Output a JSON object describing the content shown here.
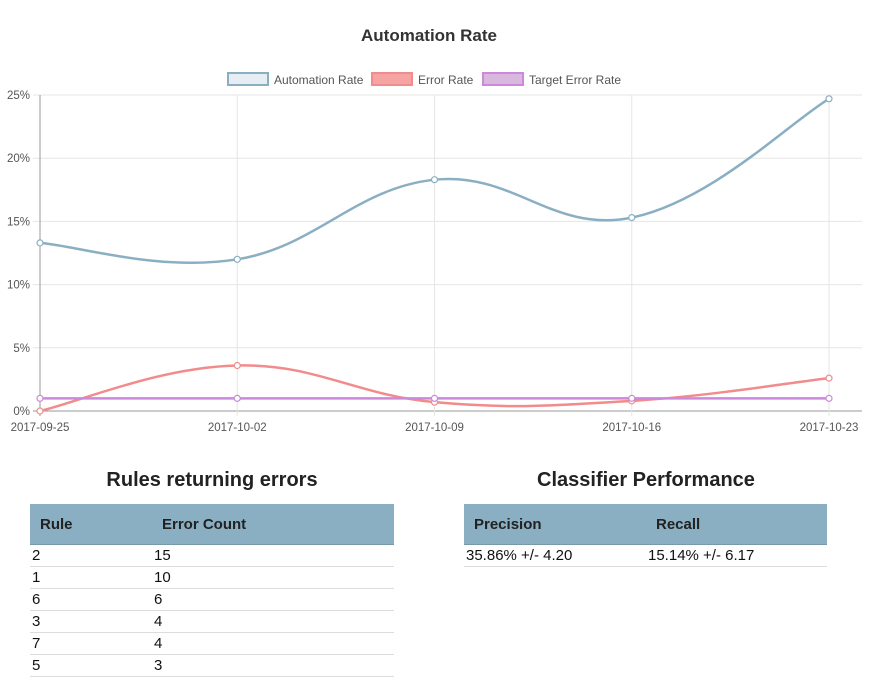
{
  "chart_data": {
    "type": "line",
    "title": "Automation Rate",
    "x": [
      "2017-09-25",
      "2017-10-02",
      "2017-10-09",
      "2017-10-16",
      "2017-10-23"
    ],
    "series": [
      {
        "name": "Automation Rate",
        "values": [
          13.3,
          12.0,
          18.3,
          15.3,
          24.7
        ],
        "color": "#8aafc2",
        "fill": "#e6eef3"
      },
      {
        "name": "Error Rate",
        "values": [
          0.0,
          3.6,
          0.7,
          0.8,
          2.6
        ],
        "color": "#f28b8b",
        "fill": "#f5a3a3"
      },
      {
        "name": "Target Error Rate",
        "values": [
          1.0,
          1.0,
          1.0,
          1.0,
          1.0
        ],
        "color": "#cc88dd",
        "fill": "#d9b8dd"
      }
    ],
    "y_ticks": [
      "0%",
      "5%",
      "10%",
      "15%",
      "20%",
      "25%"
    ],
    "ylim": [
      0,
      25
    ],
    "legend_position": "top",
    "grid": true
  },
  "rules": {
    "title": "Rules returning errors",
    "columns": [
      "Rule",
      "Error Count"
    ],
    "rows": [
      [
        "2",
        "15"
      ],
      [
        "1",
        "10"
      ],
      [
        "6",
        "6"
      ],
      [
        "3",
        "4"
      ],
      [
        "7",
        "4"
      ],
      [
        "5",
        "3"
      ]
    ]
  },
  "classifier": {
    "title": "Classifier Performance",
    "columns": [
      "Precision",
      "Recall"
    ],
    "rows": [
      [
        "35.86% +/- 4.20",
        "15.14% +/- 6.17"
      ]
    ]
  }
}
